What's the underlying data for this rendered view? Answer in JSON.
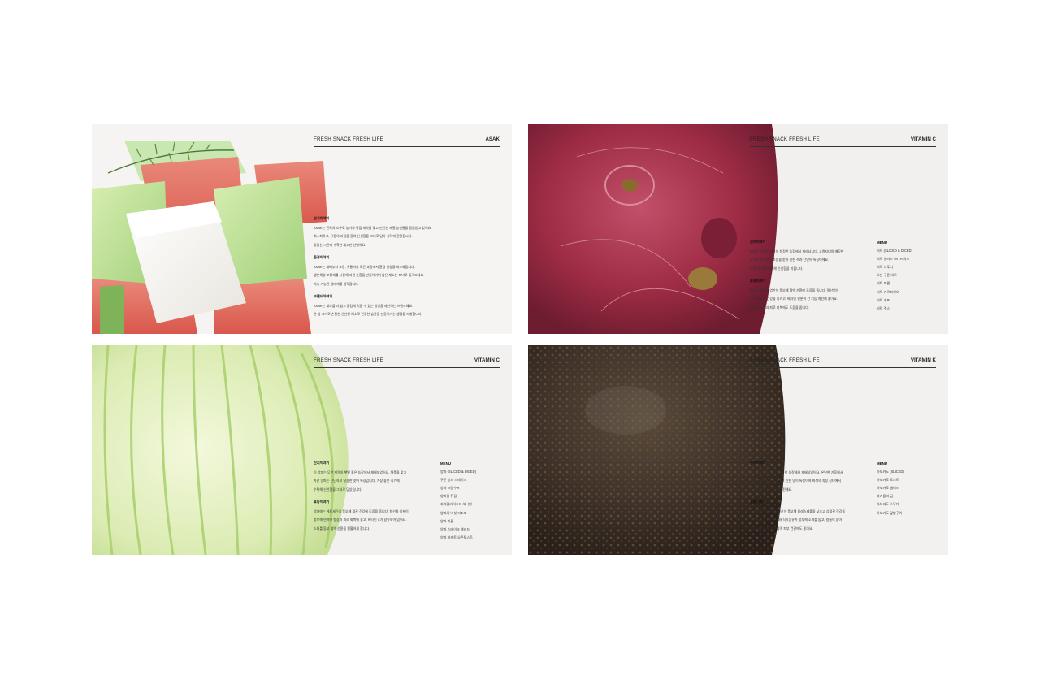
{
  "panels": [
    {
      "header_left": "FRESH SNACK FRESH LIFE",
      "header_right": "ASAK",
      "sections": [
        {
          "title": "산지이야기",
          "lines": [
            "ASAK는 전국의 소규모 농가와 직접 계약을 맺고 신선한 제철 농산물을 공급받고 있어요.",
            "최소화하고, 유통의 과정을 줄여 신선함을 그대로 담아 식탁에 전달합니다.",
            "맛있는 시간에 수확한 채소만 선별해요."
          ]
        },
        {
          "title": "환경이야기",
          "lines": [
            "ASAK는 재배부터 포장, 유통까지 모든 과정에서 환경 영향을 최소화합니다.",
            "생분해성 포장재를 사용해 자원 순환을 만들어가며 남은 채소는 퇴비로 돌려보내요.",
            "지속 가능한 생태계를 생각합니다."
          ]
        },
        {
          "title": "브랜드이야기",
          "lines": [
            "ASAK는 채소를 더 쉽고 즐겁게 먹을 수 있는 일상을 제안하는 브랜드예요.",
            "한 입 크기로 손질한 신선한 채소로 건강한 습관을 만들어가는 생활을 지향합니다."
          ]
        }
      ]
    },
    {
      "header_left": "FRESH SNACK FRESH LIFE",
      "header_right": "VITAMIN C",
      "sections": [
        {
          "title": "산지이야기",
          "lines": [
            "비트는 강원도 평창의 청정한 농장에서 자라납니다. 고원지대의 깨끗한",
            "공기와 풍부한 일조량을 받아 진한 색과 단맛이 특징이에요.",
            "수확 후 바로 세척해 신선함을 지킵니다."
          ]
        },
        {
          "title": "효능이야기",
          "lines": [
            "비트는 혈압과 염산이 풍부해 혈액 순환에 도움을 줍니다. 질산염이",
            "풍부해 혈관 건강을 지키고, 베타인 성분이 간 기능 개선에 좋아요.",
            "면역력 향상과 피로 회복에도 도움을 줍니다."
          ]
        }
      ],
      "menu_title": "MENU",
      "menu": [
        "비트 (SLICED & DICED)",
        "비트 샐러드 WITH 치즈",
        "비트 스무디",
        "오븐 구운 비트",
        "비트 피클",
        "비트 카르파치오",
        "비트 수프",
        "비트 주스"
      ]
    },
    {
      "header_left": "FRESH SNACK FRESH LIFE",
      "header_right": "VITAMIN C",
      "sections": [
        {
          "title": "산지이야기",
          "lines": [
            "이 양파는 무안 지역의 햇볕 좋은 농장에서 재배되었어요. 해풍을 맞고",
            "자란 양파는 단단하고 달콤한 맛이 특징입니다. 가장 좋은 시기에",
            "수확해 신선함을 그대로 담았습니다."
          ]
        },
        {
          "title": "효능이야기",
          "lines": [
            "양파에는 케르세틴이 풍부해 혈관 건강에 도움을 줍니다. 항산화 성분이",
            "풍부해 면역력 향상과 피로 회복에 좋고, 비타민 C가 함유되어 있어요.",
            "소화를 돕고 혈액 순환을 원활하게 합니다."
          ]
        }
      ],
      "menu_title": "MENU",
      "menu": [
        "양파 (SLICED & DICED)",
        "구운 양파 스테이크",
        "양파 크림수프",
        "양파링 튀김",
        "카라멜라이즈드 어니언",
        "양파와 버섯 리조또",
        "양파 피클",
        "양파 스테이크 샐러드",
        "양파 바게트 오픈토스트"
      ]
    },
    {
      "header_left": "FRESH SNACK FRESH LIFE",
      "header_right": "VITAMIN K",
      "sections": [
        {
          "title": "산지이야기",
          "lines": [
            "아보카도는 제주도의 따뜻한 농장에서 재배되었어요. 온난한 기후에서",
            "자란 아보카도는 부드럽고 진한 맛이 특징이며 최적의 숙성 상태에서",
            "수확하여 고소한 풍미를 전해요."
          ]
        },
        {
          "title": "효능이야기",
          "lines": [
            "아보카도는 불포화지방산이 풍부해 콜레스테롤을 낮추고 심혈관 건강을",
            "지켜줍니다. 비타민 K와 식이섬유가 풍부해 소화를 돕고, 칼륨이 많아",
            "혈압 조절에 도움이 되며 피부 건강에도 좋아요."
          ]
        }
      ],
      "menu_title": "MENU",
      "menu": [
        "아보카도 (SLICED)",
        "아보카도 토스트",
        "아보카도 샐러드",
        "과카몰리 딥",
        "아보카도 스무디",
        "아보카도 덮밥구이"
      ]
    }
  ]
}
